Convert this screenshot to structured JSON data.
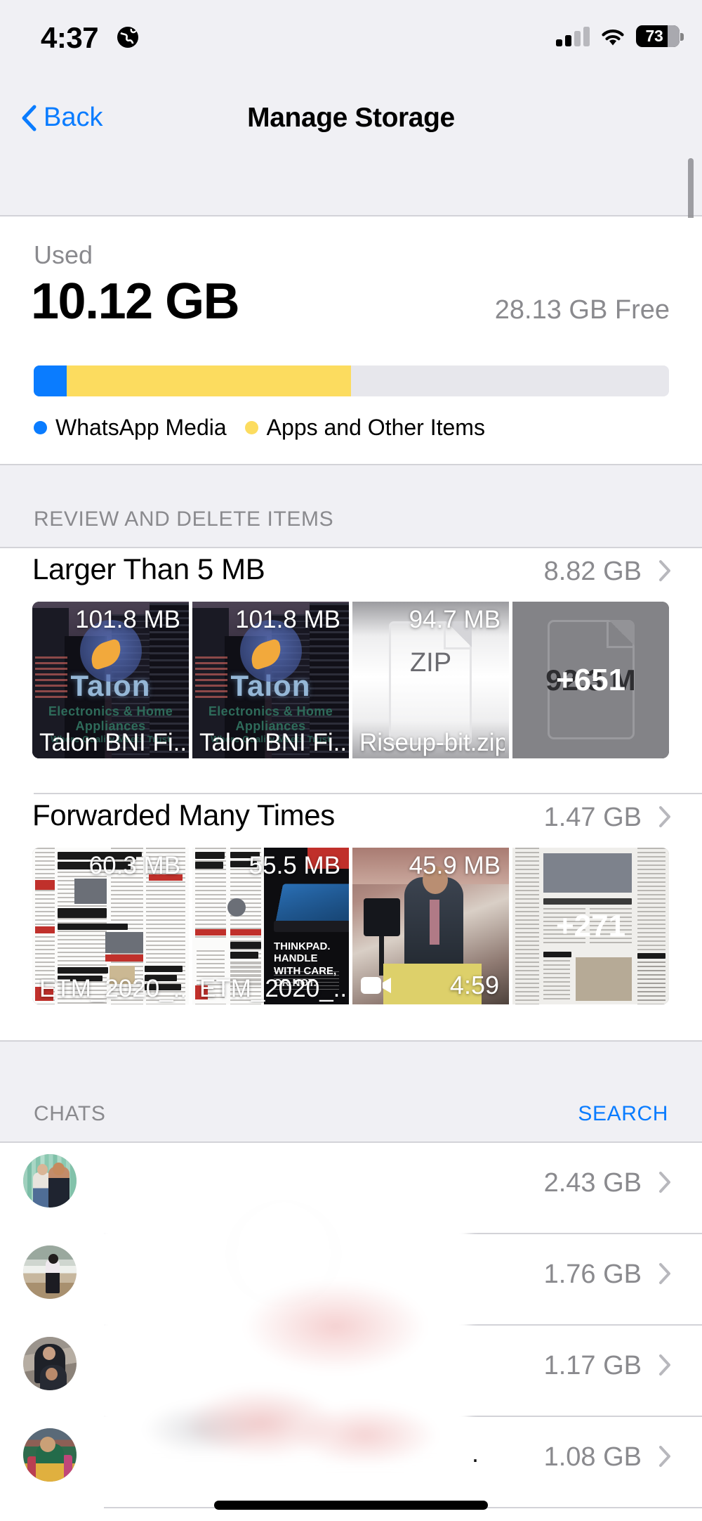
{
  "status_bar": {
    "time": "4:37",
    "location_icon": "globe-icon",
    "signal_icon": "cellular-signal-icon",
    "wifi_icon": "wifi-icon",
    "battery_percent": "73",
    "battery_icon": "battery-icon"
  },
  "nav": {
    "back_label": "Back",
    "back_icon": "chevron-left-icon",
    "title": "Manage Storage"
  },
  "summary": {
    "used_label": "Used",
    "used_value": "10.12 GB",
    "free_value": "28.13 GB Free",
    "bar": {
      "media_percent": 5.2,
      "apps_percent": 44.8,
      "free_percent": 50.0,
      "media_color": "#0a7cff",
      "apps_color": "#fcdc5f",
      "track_color": "#e7e7ec"
    },
    "legend": [
      {
        "label": "WhatsApp Media",
        "color": "#0a7cff"
      },
      {
        "label": "Apps and Other Items",
        "color": "#fcdc5f"
      }
    ]
  },
  "review_section": {
    "header": "REVIEW AND DELETE ITEMS",
    "rows": [
      {
        "title": "Larger Than 5 MB",
        "size": "8.82 GB",
        "chevron_icon": "chevron-right-icon",
        "thumbs": [
          {
            "art": "talon",
            "size": "101.8 MB",
            "name": "Talon BNI Fi...",
            "count": "",
            "duration": "",
            "logo_word": "Talon",
            "logo_sub": "Electronics & Home Appliances",
            "logo_sub2": "Where Quality Meets Trust"
          },
          {
            "art": "talon",
            "size": "101.8 MB",
            "name": "Talon BNI Fi...",
            "count": "",
            "duration": "",
            "logo_word": "Talon",
            "logo_sub": "Electronics & Home Appliances",
            "logo_sub2": "Where Quality Meets Trust"
          },
          {
            "art": "zip",
            "size": "94.7 MB",
            "name": "Riseup-bit.zip",
            "count": "",
            "duration": "",
            "zip_label": "ZIP"
          },
          {
            "art": "grey",
            "size": "",
            "name": "",
            "count": "+651",
            "duration": "",
            "ghost_size": "92.3 M"
          }
        ]
      },
      {
        "title": "Forwarded Many Times",
        "size": "1.47 GB",
        "chevron_icon": "chevron-right-icon",
        "thumbs": [
          {
            "art": "news-a",
            "size": "60.3 MB",
            "name": "ETM_2020_...",
            "count": "",
            "duration": ""
          },
          {
            "art": "news-b",
            "size": "55.5 MB",
            "name": "ETM_2020_...",
            "count": "",
            "duration": ""
          },
          {
            "art": "video",
            "size": "45.9 MB",
            "name": "",
            "count": "",
            "duration": "4:59",
            "video_icon": "video-camera-icon"
          },
          {
            "art": "news-c",
            "size": "",
            "name": "",
            "count": "+271",
            "duration": ""
          }
        ]
      }
    ]
  },
  "chats_section": {
    "header": "CHATS",
    "search_label": "SEARCH",
    "rows": [
      {
        "avatar": "avatar-couple-fence",
        "name": "",
        "size": "2.43 GB",
        "chevron_icon": "chevron-right-icon"
      },
      {
        "avatar": "avatar-person-beach",
        "name": "",
        "size": "1.76 GB",
        "chevron_icon": "chevron-right-icon"
      },
      {
        "avatar": "avatar-two-people-rocks",
        "name": "",
        "size": "1.17 GB",
        "chevron_icon": "chevron-right-icon"
      },
      {
        "avatar": "avatar-traditional-dress",
        "name": ".",
        "size": "1.08 GB",
        "chevron_icon": "chevron-right-icon"
      }
    ]
  },
  "home_indicator": "home-indicator"
}
